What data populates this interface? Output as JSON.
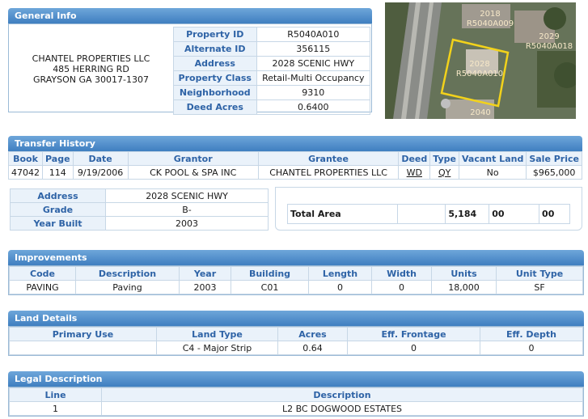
{
  "general_info": {
    "header": "General Info",
    "owner": {
      "name": "CHANTEL PROPERTIES LLC",
      "address1": "485 HERRING RD",
      "address2": "GRAYSON GA 30017-1307"
    },
    "rows": [
      {
        "label": "Property ID",
        "value": "R5040A010"
      },
      {
        "label": "Alternate ID",
        "value": "356115"
      },
      {
        "label": "Address",
        "value": "2028 SCENIC HWY"
      },
      {
        "label": "Property Class",
        "value": "Retail-Multi Occupancy"
      },
      {
        "label": "Neighborhood",
        "value": "9310"
      },
      {
        "label": "Deed Acres",
        "value": "0.6400"
      }
    ]
  },
  "map": {
    "labels": [
      {
        "num": "2018",
        "id": "R5040A009"
      },
      {
        "num": "2029",
        "id": "R5040A018"
      },
      {
        "num": "2028",
        "id": "R5040A010"
      },
      {
        "num": "2040",
        "id": ""
      }
    ]
  },
  "transfer_history": {
    "header": "Transfer History",
    "columns": [
      "Book",
      "Page",
      "Date",
      "Grantor",
      "Grantee",
      "Deed",
      "Type",
      "Vacant Land",
      "Sale Price"
    ],
    "row": [
      "47042",
      "114",
      "9/19/2006",
      "CK POOL & SPA INC",
      "CHANTEL PROPERTIES LLC",
      "WD",
      "QY",
      "No",
      "$965,000"
    ]
  },
  "building": {
    "rows": [
      {
        "label": "Address",
        "value": "2028 SCENIC HWY"
      },
      {
        "label": "Grade",
        "value": "B-"
      },
      {
        "label": "Year Built",
        "value": "2003"
      }
    ],
    "total_area": {
      "label": "Total Area",
      "value": "5,184",
      "v2": "00",
      "v3": "00"
    }
  },
  "improvements": {
    "header": "Improvements",
    "columns": [
      "Code",
      "Description",
      "Year",
      "Building",
      "Length",
      "Width",
      "Units",
      "Unit Type"
    ],
    "row": [
      "PAVING",
      "Paving",
      "2003",
      "C01",
      "0",
      "0",
      "18,000",
      "SF"
    ]
  },
  "land_details": {
    "header": "Land Details",
    "columns": [
      "Primary Use",
      "Land Type",
      "Acres",
      "Eff. Frontage",
      "Eff. Depth"
    ],
    "row": [
      "",
      "C4 - Major Strip",
      "0.64",
      "0",
      "0"
    ]
  },
  "legal_description": {
    "header": "Legal Description",
    "columns": [
      "Line",
      "Description"
    ],
    "row": [
      "1",
      "L2 BC DOGWOOD ESTATES"
    ]
  }
}
